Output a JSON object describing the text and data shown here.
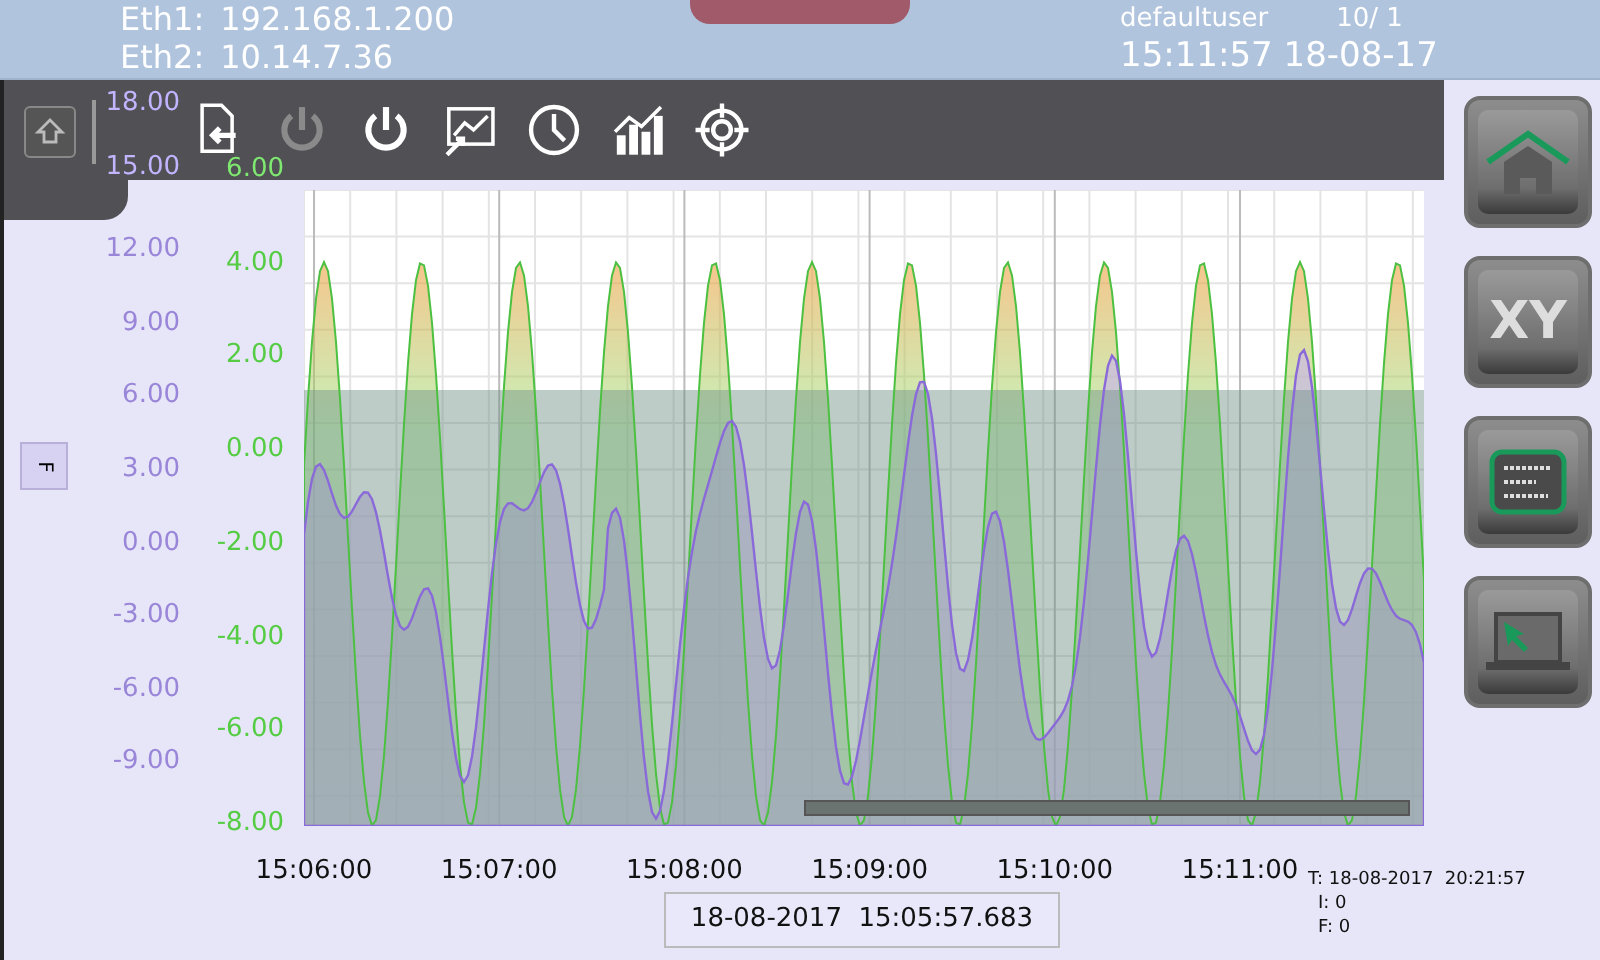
{
  "header": {
    "eth1_label": "Eth1:",
    "eth1": "192.168.1.200",
    "eth2_label": "Eth2:",
    "eth2": "10.14.7.36",
    "user": "defaultuser",
    "page": "10/ 1",
    "datetime": "15:11:57 18-08-17"
  },
  "toolbar": {
    "buttons": [
      {
        "kind": "export",
        "disabled": false
      },
      {
        "kind": "power",
        "disabled": true
      },
      {
        "kind": "power",
        "disabled": false
      },
      {
        "kind": "trend",
        "disabled": false
      },
      {
        "kind": "clock",
        "disabled": false
      },
      {
        "kind": "bars",
        "disabled": false
      },
      {
        "kind": "target",
        "disabled": false
      }
    ]
  },
  "side_tab": {
    "label": "F"
  },
  "left_axis": [
    "18.00",
    "15.00",
    "12.00",
    "9.00",
    "6.00",
    "3.00",
    "0.00",
    "-3.00",
    "-6.00",
    "-9.00"
  ],
  "right_axis": [
    "6.00",
    "4.00",
    "2.00",
    "0.00",
    "-2.00",
    "-4.00",
    "-6.00",
    "-8.00"
  ],
  "x_axis": [
    "15:06:00",
    "15:07:00",
    "15:08:00",
    "15:09:00",
    "15:10:00",
    "15:11:00"
  ],
  "cursor_time": "18-08-2017  15:05:57.683",
  "info": [
    "T: 18-08-2017  20:21:57",
    "I: 0",
    "F: 0"
  ],
  "side_buttons": [
    {
      "kind": "home"
    },
    {
      "kind": "text",
      "label": "XY"
    },
    {
      "kind": "binary"
    },
    {
      "kind": "pointer"
    }
  ]
}
